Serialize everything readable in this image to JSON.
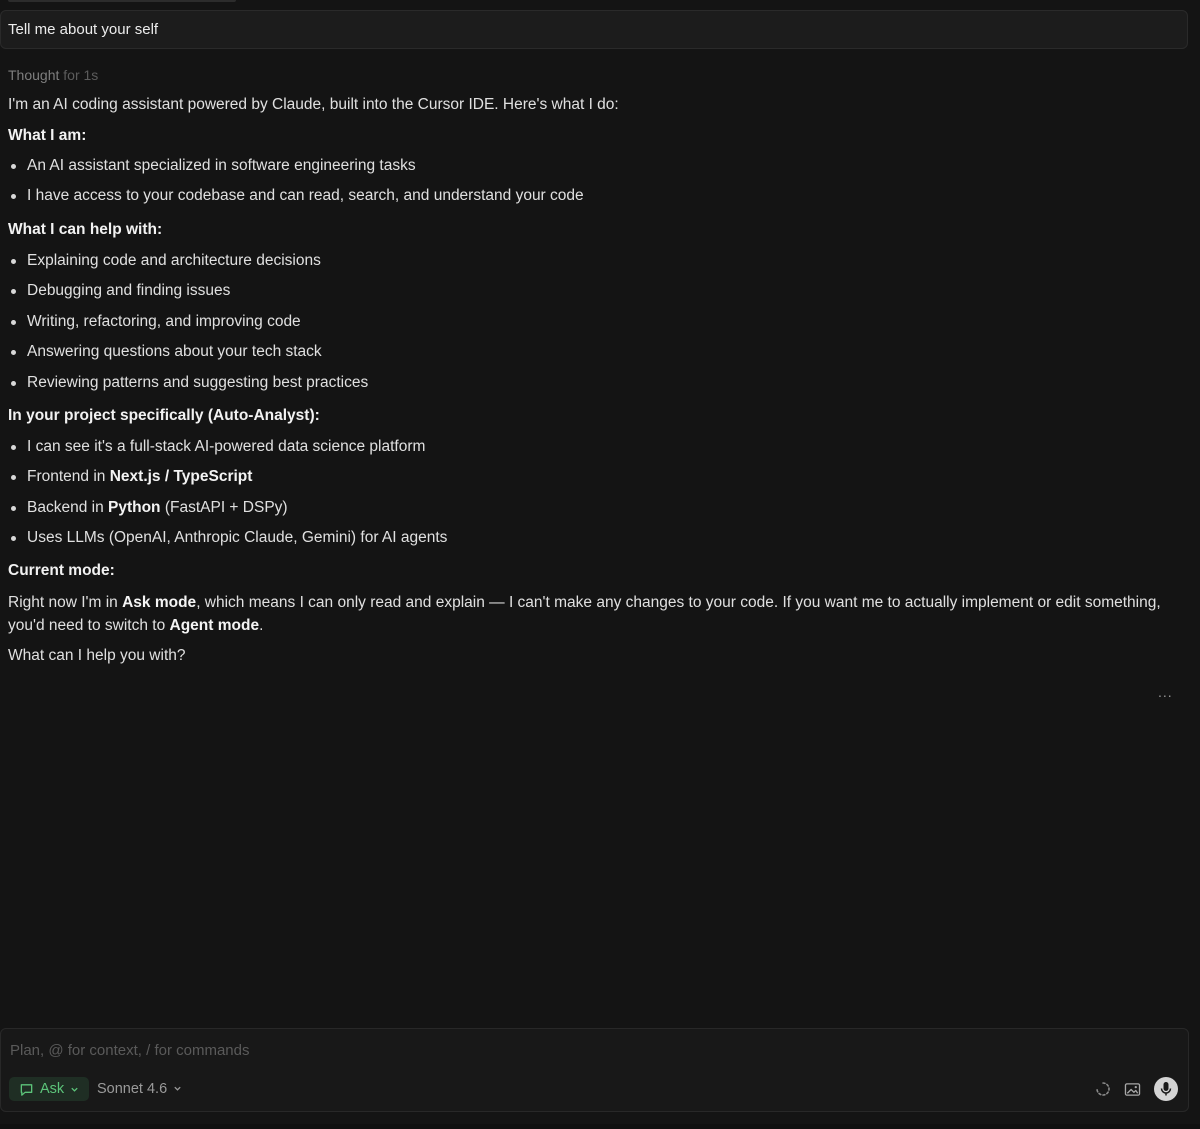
{
  "user_message": "Tell me about your self",
  "thought": {
    "label": "Thought",
    "duration": "for 1s"
  },
  "response": {
    "intro": "I'm an AI coding assistant powered by Claude, built into the Cursor IDE. Here's what I do:",
    "section1": {
      "heading": "What I am:",
      "items": [
        "An AI assistant specialized in software engineering tasks",
        "I have access to your codebase and can read, search, and understand your code"
      ]
    },
    "section2": {
      "heading": "What I can help with:",
      "items": [
        "Explaining code and architecture decisions",
        "Debugging and finding issues",
        "Writing, refactoring, and improving code",
        "Answering questions about your tech stack",
        "Reviewing patterns and suggesting best practices"
      ]
    },
    "section3": {
      "heading": "In your project specifically (Auto-Analyst):",
      "item1": "I can see it's a full-stack AI-powered data science platform",
      "item2": {
        "prefix": "Frontend in ",
        "bold": "Next.js / TypeScript"
      },
      "item3": {
        "prefix": "Backend in ",
        "bold": "Python",
        "suffix": " (FastAPI + DSPy)"
      },
      "item4": "Uses LLMs (OpenAI, Anthropic Claude, Gemini) for AI agents"
    },
    "section4": {
      "heading": "Current mode:",
      "part1": "Right now I'm in ",
      "bold1": "Ask mode",
      "part2": ", which means I can only read and explain — I can't make any changes to your code. If you want me to actually implement or edit something, you'd need to switch to ",
      "bold2": "Agent mode",
      "part3": "."
    },
    "closing": "What can I help you with?"
  },
  "more_actions": "...",
  "composer": {
    "placeholder": "Plan, @ for context, / for commands",
    "mode_label": "Ask",
    "model_label": "Sonnet 4.6"
  },
  "colors": {
    "background": "#141414",
    "ask_mode_accent": "#5cc47a"
  },
  "icons": [
    "chat-icon",
    "chevron-down-icon",
    "spinner-icon",
    "image-icon",
    "microphone-icon"
  ]
}
